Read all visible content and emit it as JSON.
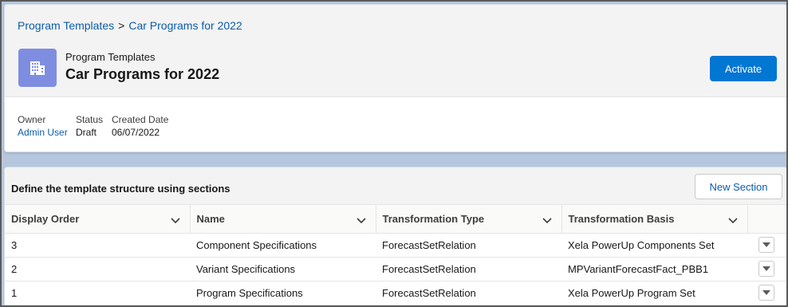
{
  "breadcrumb": {
    "parent": "Program Templates",
    "separator": ">",
    "current": "Car Programs for 2022"
  },
  "header": {
    "object_label": "Program Templates",
    "title": "Car Programs for 2022",
    "icon": "building-icon",
    "icon_color": "#7f8de1",
    "activate_label": "Activate"
  },
  "fields": {
    "owner_label": "Owner",
    "owner_value": "Admin User",
    "status_label": "Status",
    "status_value": "Draft",
    "created_label": "Created Date",
    "created_value": "06/07/2022"
  },
  "sections": {
    "title": "Define the template structure using sections",
    "new_section_label": "New Section",
    "columns": [
      "Display Order",
      "Name",
      "Transformation Type",
      "Transformation Basis"
    ],
    "rows": [
      {
        "order": "3",
        "name": "Component Specifications",
        "type": "ForecastSetRelation",
        "basis": "Xela PowerUp Components Set"
      },
      {
        "order": "2",
        "name": "Variant Specifications",
        "type": "ForecastSetRelation",
        "basis": "MPVariantForecastFact_PBB1"
      },
      {
        "order": "1",
        "name": "Program Specifications",
        "type": "ForecastSetRelation",
        "basis": "Xela PowerUp Program Set"
      }
    ]
  },
  "colors": {
    "brand": "#0176d3",
    "link": "#0b5cab"
  }
}
